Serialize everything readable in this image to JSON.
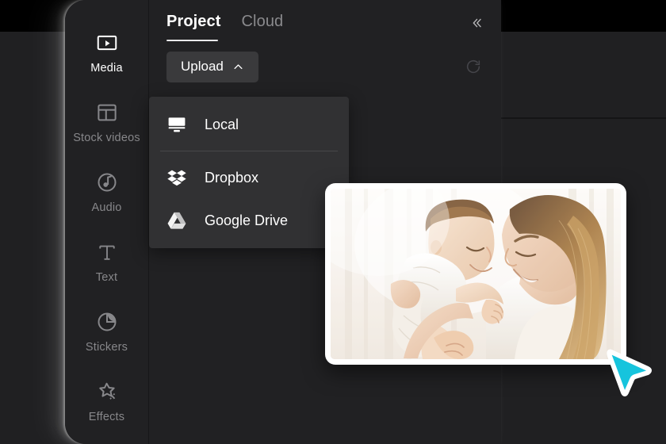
{
  "theme": {
    "window_bg": "#212123",
    "editor_bg": "#202022",
    "menu_bg": "#313133",
    "accent_text": "#ffffff",
    "muted_text": "#87878a",
    "button_bg": "#3a3a3c",
    "cursor_color": "#16c4dd",
    "card_bg": "#ffffff"
  },
  "sidebar": {
    "items": [
      {
        "label": "Media",
        "icon": "media-icon",
        "active": true
      },
      {
        "label": "Stock videos",
        "icon": "stock-videos-icon",
        "active": false
      },
      {
        "label": "Audio",
        "icon": "audio-icon",
        "active": false
      },
      {
        "label": "Text",
        "icon": "text-icon",
        "active": false
      },
      {
        "label": "Stickers",
        "icon": "stickers-icon",
        "active": false
      },
      {
        "label": "Effects",
        "icon": "effects-icon",
        "active": false
      }
    ]
  },
  "panel": {
    "tabs": [
      {
        "label": "Project",
        "active": true
      },
      {
        "label": "Cloud",
        "active": false
      }
    ],
    "collapse_icon": "double-chevron-left-icon",
    "toolbar": {
      "upload_label": "Upload",
      "upload_chevron_icon": "chevron-up-icon",
      "refresh_icon": "refresh-icon"
    },
    "upload_menu": {
      "items": [
        {
          "label": "Local",
          "icon": "monitor-icon"
        },
        {
          "label": "Dropbox",
          "icon": "dropbox-icon"
        },
        {
          "label": "Google Drive",
          "icon": "google-drive-icon"
        }
      ]
    }
  },
  "media_card": {
    "alt": "Mother holding smiling baby near bright window",
    "icon": "photo-thumbnail"
  },
  "pointer": {
    "icon": "cursor-arrow-icon"
  }
}
